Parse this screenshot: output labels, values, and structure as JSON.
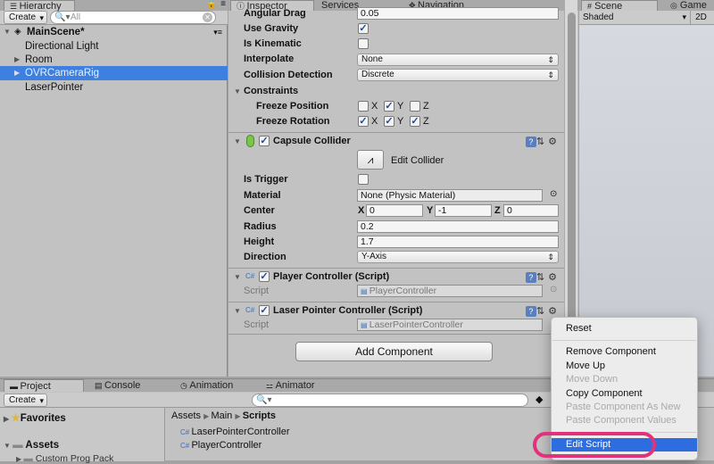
{
  "hierarchy": {
    "tab": "Hierarchy",
    "create": "Create",
    "search_placeholder": "All",
    "scene_name": "MainScene*",
    "items": [
      {
        "label": "Directional Light"
      },
      {
        "label": "Room"
      },
      {
        "label": "OVRCameraRig"
      },
      {
        "label": "LaserPointer"
      }
    ]
  },
  "tabs": {
    "inspector": "Inspector",
    "services": "Services",
    "navigation": "Navigation",
    "scene": "Scene",
    "game": "Game",
    "shaded": "Shaded",
    "two_d": "2D"
  },
  "rigidbody": {
    "angular_drag_label": "Angular Drag",
    "angular_drag_value": "0.05",
    "use_gravity": "Use Gravity",
    "is_kinematic": "Is Kinematic",
    "interpolate": "Interpolate",
    "interpolate_value": "None",
    "collision_detection": "Collision Detection",
    "collision_detection_value": "Discrete",
    "constraints": "Constraints",
    "freeze_position": "Freeze Position",
    "freeze_rotation": "Freeze Rotation",
    "x": "X",
    "y": "Y",
    "z": "Z"
  },
  "capsule": {
    "title": "Capsule Collider",
    "edit_collider": "Edit Collider",
    "is_trigger": "Is Trigger",
    "material": "Material",
    "material_value": "None (Physic Material)",
    "center": "Center",
    "center_x": "0",
    "center_y": "-1",
    "center_z": "0",
    "radius": "Radius",
    "radius_value": "0.2",
    "height": "Height",
    "height_value": "1.7",
    "direction": "Direction",
    "direction_value": "Y-Axis"
  },
  "player_controller": {
    "title": "Player Controller (Script)",
    "script_label": "Script",
    "script_value": "PlayerController"
  },
  "laser_controller": {
    "title": "Laser Pointer Controller (Script)",
    "script_label": "Script",
    "script_value": "LaserPointerController"
  },
  "add_component": "Add Component",
  "project": {
    "tabs": [
      "Project",
      "Console",
      "Animation",
      "Animator"
    ],
    "create": "Create",
    "favorites": "Favorites",
    "assets": "Assets",
    "partial_child": "Custom Prog Pack",
    "breadcrumb": [
      "Assets",
      "Main",
      "Scripts"
    ],
    "files": [
      "LaserPointerController",
      "PlayerController"
    ]
  },
  "context_menu": {
    "items": [
      {
        "label": "Reset"
      },
      {
        "label": "Remove Component"
      },
      {
        "label": "Move Up"
      },
      {
        "label": "Move Down"
      },
      {
        "label": "Copy Component"
      },
      {
        "label": "Paste Component As New"
      },
      {
        "label": "Paste Component Values"
      },
      {
        "label": "Edit Script"
      }
    ]
  },
  "colors": {
    "selection": "#3d80df",
    "menu_highlight": "#2d6de0",
    "annotation_ring": "#e2327a"
  }
}
